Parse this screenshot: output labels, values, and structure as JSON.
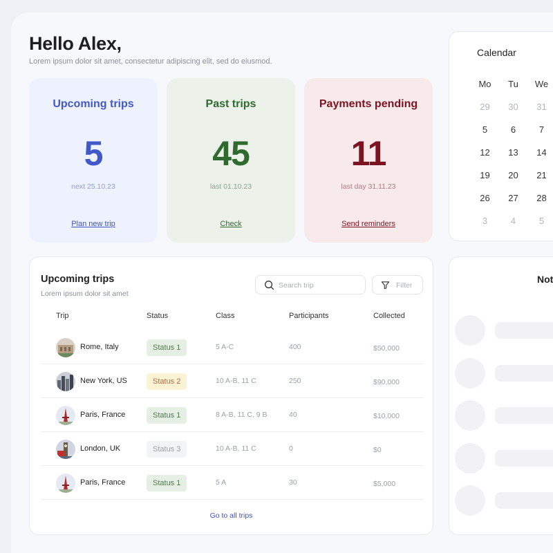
{
  "header": {
    "greeting": "Hello Alex,",
    "subtitle": "Lorem ipsum dolor sit amet, consectetur adipiscing elit, sed do eiusmod."
  },
  "stats": [
    {
      "title": "Upcoming trips",
      "value": "5",
      "sub": "next 25.10.23",
      "link": "Plan new trip"
    },
    {
      "title": "Past trips",
      "value": "45",
      "sub": "last 01.10.23",
      "link": "Check"
    },
    {
      "title": "Payments pending",
      "value": "11",
      "sub": "last day 31.11.23",
      "link": "Send reminders"
    }
  ],
  "calendar": {
    "title": "Calendar",
    "weekdays": [
      "Mo",
      "Tu",
      "We"
    ],
    "weeks": [
      [
        {
          "d": "29",
          "muted": true
        },
        {
          "d": "30",
          "muted": true
        },
        {
          "d": "31",
          "muted": true
        }
      ],
      [
        {
          "d": "5"
        },
        {
          "d": "6"
        },
        {
          "d": "7"
        }
      ],
      [
        {
          "d": "12"
        },
        {
          "d": "13"
        },
        {
          "d": "14"
        }
      ],
      [
        {
          "d": "19"
        },
        {
          "d": "20"
        },
        {
          "d": "21"
        }
      ],
      [
        {
          "d": "26"
        },
        {
          "d": "27"
        },
        {
          "d": "28"
        }
      ],
      [
        {
          "d": "3",
          "muted": true
        },
        {
          "d": "4",
          "muted": true
        },
        {
          "d": "5",
          "muted": true
        }
      ]
    ]
  },
  "trips": {
    "title": "Upcoming trips",
    "subtitle": "Lorem ipsum dolor sit amet",
    "search_placeholder": "Search trip",
    "filter_label": "Filter",
    "columns": [
      "Trip",
      "Status",
      "Class",
      "Participants",
      "Collected"
    ],
    "rows": [
      {
        "trip": "Rome, Italy",
        "status": "Status 1",
        "status_kind": 1,
        "class": "5 A-C",
        "participants": "400",
        "collected": "$50,000",
        "thumb": "rome"
      },
      {
        "trip": "New York, US",
        "status": "Status 2",
        "status_kind": 2,
        "class": "10 A-B, 11 C",
        "participants": "250",
        "collected": "$90,000",
        "thumb": "newyork"
      },
      {
        "trip": "Paris, France",
        "status": "Status 1",
        "status_kind": 1,
        "class": "8 A-B, 11 C, 9 B",
        "participants": "40",
        "collected": "$10,000",
        "thumb": "paris"
      },
      {
        "trip": "London, UK",
        "status": "Status 3",
        "status_kind": 3,
        "class": "10 A-B, 11 C",
        "participants": "0",
        "collected": "$0",
        "thumb": "london"
      },
      {
        "trip": "Paris, France",
        "status": "Status 1",
        "status_kind": 1,
        "class": "5 A",
        "participants": "30",
        "collected": "$5,000",
        "thumb": "paris"
      }
    ],
    "footer_link": "Go to all trips"
  },
  "notifications": {
    "title": "Not"
  }
}
